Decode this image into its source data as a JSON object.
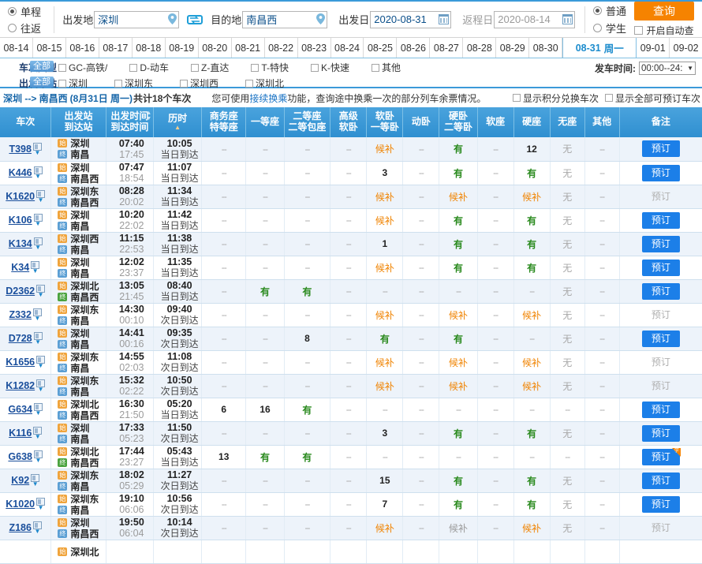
{
  "search": {
    "trip_types": [
      {
        "label": "单程",
        "selected": true
      },
      {
        "label": "往返",
        "selected": false
      }
    ],
    "from_label": "出发地",
    "from_value": "深圳",
    "to_label": "目的地",
    "to_value": "南昌西",
    "swap_icon": "swap-horizontal-icon",
    "depart_label": "出发日",
    "depart_value": "2020-08-31",
    "return_label": "返程日",
    "return_value": "2020-08-14",
    "passenger_types": [
      {
        "label": "普通",
        "selected": true
      },
      {
        "label": "学生",
        "selected": false
      }
    ],
    "query_label": "查询",
    "auto_query_label": "开启自动查",
    "auto_query_checked": false,
    "accent_orange": "#f68300",
    "accent_blue": "#1c7fe8"
  },
  "date_strip": {
    "dates": [
      {
        "label": "08-14",
        "active": false
      },
      {
        "label": "08-15",
        "active": false
      },
      {
        "label": "08-16",
        "active": false
      },
      {
        "label": "08-17",
        "active": false
      },
      {
        "label": "08-18",
        "active": false
      },
      {
        "label": "08-19",
        "active": false
      },
      {
        "label": "08-20",
        "active": false
      },
      {
        "label": "08-21",
        "active": false
      },
      {
        "label": "08-22",
        "active": false
      },
      {
        "label": "08-23",
        "active": false
      },
      {
        "label": "08-24",
        "active": false
      },
      {
        "label": "08-25",
        "active": false
      },
      {
        "label": "08-26",
        "active": false
      },
      {
        "label": "08-27",
        "active": false
      },
      {
        "label": "08-28",
        "active": false
      },
      {
        "label": "08-29",
        "active": false
      },
      {
        "label": "08-30",
        "active": false
      },
      {
        "label": "08-31",
        "weekday": "周一",
        "active": true
      },
      {
        "label": "09-01",
        "active": false
      },
      {
        "label": "09-02",
        "active": false
      }
    ]
  },
  "filters": {
    "type_label": "车次类型",
    "type_all_badge": "全部",
    "types": [
      {
        "label": "GC-高铁/",
        "checked": false
      },
      {
        "label": "D-动车",
        "checked": false
      },
      {
        "label": "Z-直达",
        "checked": false
      },
      {
        "label": "T-特快",
        "checked": false
      },
      {
        "label": "K-快速",
        "checked": false
      },
      {
        "label": "其他",
        "checked": false
      }
    ],
    "station_label": "出发车站",
    "station_all_badge": "全部",
    "stations": [
      {
        "label": "深圳",
        "checked": false
      },
      {
        "label": "深圳东",
        "checked": false
      },
      {
        "label": "深圳西",
        "checked": false
      },
      {
        "label": "深圳北",
        "checked": false
      }
    ],
    "time_label": "发车时间:",
    "time_value": "00:00--24:"
  },
  "info": {
    "route": "深圳 --> 南昌西",
    "date_text": "(8月31日 周一)",
    "count_text": "共计18个车次",
    "tip_pre": "您可使用",
    "tip_link": "接续换乘",
    "tip_post": "功能，查询途中换乘一次的部分列车余票情况。",
    "chk_points": "显示积分兑换车次",
    "chk_all": "显示全部可预订车次"
  },
  "table": {
    "headers": [
      {
        "l1": "车次",
        "l2": ""
      },
      {
        "l1": "出发站",
        "l2": "到达站"
      },
      {
        "l1": "出发时间",
        "l2": "到达时间",
        "sortable": true
      },
      {
        "l1": "历时",
        "l2": "",
        "sortmark": true
      },
      {
        "l1": "商务座",
        "l2": "特等座"
      },
      {
        "l1": "一等座",
        "l2": ""
      },
      {
        "l1": "二等座",
        "l2": "二等包座"
      },
      {
        "l1": "高级",
        "l2": "软卧"
      },
      {
        "l1": "软卧",
        "l2": "一等卧"
      },
      {
        "l1": "动卧",
        "l2": ""
      },
      {
        "l1": "硬卧",
        "l2": "二等卧"
      },
      {
        "l1": "软座",
        "l2": ""
      },
      {
        "l1": "硬座",
        "l2": ""
      },
      {
        "l1": "无座",
        "l2": ""
      },
      {
        "l1": "其他",
        "l2": ""
      },
      {
        "l1": "备注",
        "l2": ""
      }
    ],
    "book_label": "预订",
    "rows": [
      {
        "code": "T398",
        "from": "深圳",
        "to": "南昌",
        "from_tag": "start",
        "to_tag": "end",
        "dep": "07:40",
        "arr": "17:45",
        "dur": "10:05",
        "day": "当日到达",
        "seats": [
          "--",
          "--",
          "--",
          "--",
          "候补",
          "--",
          "有",
          "--",
          "12",
          "无",
          "--"
        ],
        "kinds": [
          "dash",
          "dash",
          "dash",
          "dash",
          "hb",
          "dash",
          "yes",
          "dash",
          "num",
          "no",
          "dash"
        ],
        "book": true,
        "flag": false
      },
      {
        "code": "K446",
        "from": "深圳",
        "to": "南昌西",
        "from_tag": "start",
        "to_tag": "end",
        "dep": "07:47",
        "arr": "18:54",
        "dur": "11:07",
        "day": "当日到达",
        "seats": [
          "--",
          "--",
          "--",
          "--",
          "3",
          "--",
          "有",
          "--",
          "有",
          "无",
          "--"
        ],
        "kinds": [
          "dash",
          "dash",
          "dash",
          "dash",
          "num",
          "dash",
          "yes",
          "dash",
          "yes",
          "no",
          "dash"
        ],
        "book": true,
        "flag": false
      },
      {
        "code": "K1620",
        "from": "深圳东",
        "to": "南昌西",
        "from_tag": "start",
        "to_tag": "end",
        "dep": "08:28",
        "arr": "20:02",
        "dur": "11:34",
        "day": "当日到达",
        "seats": [
          "--",
          "--",
          "--",
          "--",
          "候补",
          "--",
          "候补",
          "--",
          "候补",
          "无",
          "--"
        ],
        "kinds": [
          "dash",
          "dash",
          "dash",
          "dash",
          "hb",
          "dash",
          "hb",
          "dash",
          "hb",
          "no",
          "dash"
        ],
        "book": false,
        "flag": false
      },
      {
        "code": "K106",
        "from": "深圳",
        "to": "南昌",
        "from_tag": "start",
        "to_tag": "end",
        "dep": "10:20",
        "arr": "22:02",
        "dur": "11:42",
        "day": "当日到达",
        "seats": [
          "--",
          "--",
          "--",
          "--",
          "候补",
          "--",
          "有",
          "--",
          "有",
          "无",
          "--"
        ],
        "kinds": [
          "dash",
          "dash",
          "dash",
          "dash",
          "hb",
          "dash",
          "yes",
          "dash",
          "yes",
          "no",
          "dash"
        ],
        "book": true,
        "flag": false
      },
      {
        "code": "K134",
        "from": "深圳西",
        "to": "南昌",
        "from_tag": "start",
        "to_tag": "end",
        "dep": "11:15",
        "arr": "22:53",
        "dur": "11:38",
        "day": "当日到达",
        "seats": [
          "--",
          "--",
          "--",
          "--",
          "1",
          "--",
          "有",
          "--",
          "有",
          "无",
          "--"
        ],
        "kinds": [
          "dash",
          "dash",
          "dash",
          "dash",
          "num",
          "dash",
          "yes",
          "dash",
          "yes",
          "no",
          "dash"
        ],
        "book": true,
        "flag": false
      },
      {
        "code": "K34",
        "from": "深圳",
        "to": "南昌",
        "from_tag": "start",
        "to_tag": "end",
        "dep": "12:02",
        "arr": "23:37",
        "dur": "11:35",
        "day": "当日到达",
        "seats": [
          "--",
          "--",
          "--",
          "--",
          "候补",
          "--",
          "有",
          "--",
          "有",
          "无",
          "--"
        ],
        "kinds": [
          "dash",
          "dash",
          "dash",
          "dash",
          "hb",
          "dash",
          "yes",
          "dash",
          "yes",
          "no",
          "dash"
        ],
        "book": true,
        "flag": false
      },
      {
        "code": "D2362",
        "from": "深圳北",
        "to": "南昌西",
        "from_tag": "start",
        "to_tag": "endg",
        "dep": "13:05",
        "arr": "21:45",
        "dur": "08:40",
        "day": "当日到达",
        "seats": [
          "--",
          "有",
          "有",
          "--",
          "--",
          "--",
          "--",
          "--",
          "--",
          "无",
          "--"
        ],
        "kinds": [
          "dash",
          "yes",
          "yes",
          "dash",
          "dash",
          "dash",
          "dash",
          "dash",
          "dash",
          "no",
          "dash"
        ],
        "book": true,
        "flag": false
      },
      {
        "code": "Z332",
        "from": "深圳东",
        "to": "南昌",
        "from_tag": "start",
        "to_tag": "end",
        "dep": "14:30",
        "arr": "00:10",
        "dur": "09:40",
        "day": "次日到达",
        "seats": [
          "--",
          "--",
          "--",
          "--",
          "候补",
          "--",
          "候补",
          "--",
          "候补",
          "无",
          "--"
        ],
        "kinds": [
          "dash",
          "dash",
          "dash",
          "dash",
          "hb",
          "dash",
          "hb",
          "dash",
          "hb",
          "no",
          "dash"
        ],
        "book": false,
        "flag": false
      },
      {
        "code": "D728",
        "from": "深圳",
        "to": "南昌",
        "from_tag": "start",
        "to_tag": "end",
        "dep": "14:41",
        "arr": "00:16",
        "dur": "09:35",
        "day": "次日到达",
        "seats": [
          "--",
          "--",
          "8",
          "--",
          "有",
          "--",
          "有",
          "--",
          "--",
          "无",
          "--"
        ],
        "kinds": [
          "dash",
          "dash",
          "num",
          "dash",
          "yes",
          "dash",
          "yes",
          "dash",
          "dash",
          "no",
          "dash"
        ],
        "book": true,
        "flag": false
      },
      {
        "code": "K1656",
        "from": "深圳东",
        "to": "南昌",
        "from_tag": "start",
        "to_tag": "end",
        "dep": "14:55",
        "arr": "02:03",
        "dur": "11:08",
        "day": "次日到达",
        "seats": [
          "--",
          "--",
          "--",
          "--",
          "候补",
          "--",
          "候补",
          "--",
          "候补",
          "无",
          "--"
        ],
        "kinds": [
          "dash",
          "dash",
          "dash",
          "dash",
          "hb",
          "dash",
          "hb",
          "dash",
          "hb",
          "no",
          "dash"
        ],
        "book": false,
        "flag": false
      },
      {
        "code": "K1282",
        "from": "深圳东",
        "to": "南昌",
        "from_tag": "start",
        "to_tag": "end",
        "dep": "15:32",
        "arr": "02:22",
        "dur": "10:50",
        "day": "次日到达",
        "seats": [
          "--",
          "--",
          "--",
          "--",
          "候补",
          "--",
          "候补",
          "--",
          "候补",
          "无",
          "--"
        ],
        "kinds": [
          "dash",
          "dash",
          "dash",
          "dash",
          "hb",
          "dash",
          "hb",
          "dash",
          "hb",
          "no",
          "dash"
        ],
        "book": false,
        "flag": false
      },
      {
        "code": "G634",
        "from": "深圳北",
        "to": "南昌西",
        "from_tag": "start",
        "to_tag": "end",
        "dep": "16:30",
        "arr": "21:50",
        "dur": "05:20",
        "day": "当日到达",
        "seats": [
          "6",
          "16",
          "有",
          "--",
          "--",
          "--",
          "--",
          "--",
          "--",
          "--",
          "--"
        ],
        "kinds": [
          "num",
          "num",
          "yes",
          "dash",
          "dash",
          "dash",
          "dash",
          "dash",
          "dash",
          "dash",
          "dash"
        ],
        "book": true,
        "flag": false
      },
      {
        "code": "K116",
        "from": "深圳",
        "to": "南昌",
        "from_tag": "start",
        "to_tag": "end",
        "dep": "17:33",
        "arr": "05:23",
        "dur": "11:50",
        "day": "次日到达",
        "seats": [
          "--",
          "--",
          "--",
          "--",
          "3",
          "--",
          "有",
          "--",
          "有",
          "无",
          "--"
        ],
        "kinds": [
          "dash",
          "dash",
          "dash",
          "dash",
          "num",
          "dash",
          "yes",
          "dash",
          "yes",
          "no",
          "dash"
        ],
        "book": true,
        "flag": false
      },
      {
        "code": "G638",
        "from": "深圳北",
        "to": "南昌西",
        "from_tag": "start",
        "to_tag": "endg",
        "dep": "17:44",
        "arr": "23:27",
        "dur": "05:43",
        "day": "当日到达",
        "seats": [
          "13",
          "有",
          "有",
          "--",
          "--",
          "--",
          "--",
          "--",
          "--",
          "--",
          "--"
        ],
        "kinds": [
          "num",
          "yes",
          "yes",
          "dash",
          "dash",
          "dash",
          "dash",
          "dash",
          "dash",
          "dash",
          "dash"
        ],
        "book": true,
        "flag": true
      },
      {
        "code": "K92",
        "from": "深圳东",
        "to": "南昌",
        "from_tag": "start",
        "to_tag": "end",
        "dep": "18:02",
        "arr": "05:29",
        "dur": "11:27",
        "day": "次日到达",
        "seats": [
          "--",
          "--",
          "--",
          "--",
          "15",
          "--",
          "有",
          "--",
          "有",
          "无",
          "--"
        ],
        "kinds": [
          "dash",
          "dash",
          "dash",
          "dash",
          "num",
          "dash",
          "yes",
          "dash",
          "yes",
          "no",
          "dash"
        ],
        "book": true,
        "flag": false
      },
      {
        "code": "K1020",
        "from": "深圳东",
        "to": "南昌",
        "from_tag": "start",
        "to_tag": "end",
        "dep": "19:10",
        "arr": "06:06",
        "dur": "10:56",
        "day": "次日到达",
        "seats": [
          "--",
          "--",
          "--",
          "--",
          "7",
          "--",
          "有",
          "--",
          "有",
          "无",
          "--"
        ],
        "kinds": [
          "dash",
          "dash",
          "dash",
          "dash",
          "num",
          "dash",
          "yes",
          "dash",
          "yes",
          "no",
          "dash"
        ],
        "book": true,
        "flag": false
      },
      {
        "code": "Z186",
        "from": "深圳",
        "to": "南昌西",
        "from_tag": "start",
        "to_tag": "end",
        "dep": "19:50",
        "arr": "06:04",
        "dur": "10:14",
        "day": "次日到达",
        "seats": [
          "--",
          "--",
          "--",
          "--",
          "候补",
          "--",
          "候补",
          "--",
          "候补",
          "无",
          "--"
        ],
        "kinds": [
          "dash",
          "dash",
          "dash",
          "dash",
          "hb",
          "dash",
          "hbg",
          "dash",
          "hb",
          "no",
          "dash"
        ],
        "book": false,
        "flag": false
      }
    ]
  }
}
